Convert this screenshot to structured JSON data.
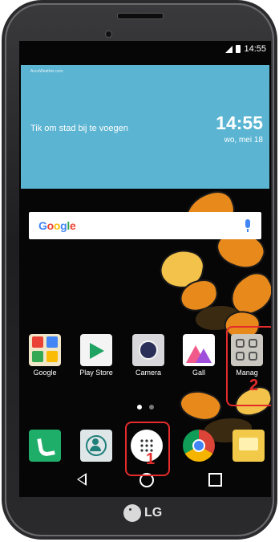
{
  "statusbar": {
    "time": "14:55"
  },
  "weather_widget": {
    "brand": "AccuWeather.com",
    "city_prompt": "Tik om stad bij te voegen",
    "time": "14:55",
    "date": "wo, mei 18"
  },
  "search": {
    "logo_letters": [
      "G",
      "o",
      "o",
      "g",
      "l",
      "e"
    ],
    "logo_colors": [
      "#4285f4",
      "#ea4335",
      "#fbbc05",
      "#4285f4",
      "#34a853",
      "#ea4335"
    ]
  },
  "home_apps": [
    {
      "label": "Google",
      "icon": "google-folder-icon"
    },
    {
      "label": "Play Store",
      "icon": "play-store-icon"
    },
    {
      "label": "Camera",
      "icon": "camera-icon"
    },
    {
      "label": "Gall",
      "icon": "gallery-icon"
    },
    {
      "label": "Manag",
      "icon": "management-folder-icon"
    }
  ],
  "dock_apps": [
    {
      "name": "phone",
      "icon": "phone-icon",
      "color": "#1fae6a"
    },
    {
      "name": "contacts",
      "icon": "contacts-icon",
      "color": "#dfe6e8"
    },
    {
      "name": "apps",
      "icon": "apps-grid-icon",
      "color": "#ffffff"
    },
    {
      "name": "chrome",
      "icon": "chrome-icon",
      "color": "#db4437"
    },
    {
      "name": "messages",
      "icon": "message-icon",
      "color": "#f3c94a"
    }
  ],
  "annotations": {
    "one": "1",
    "two": "2"
  },
  "brand": {
    "name": "LG"
  }
}
